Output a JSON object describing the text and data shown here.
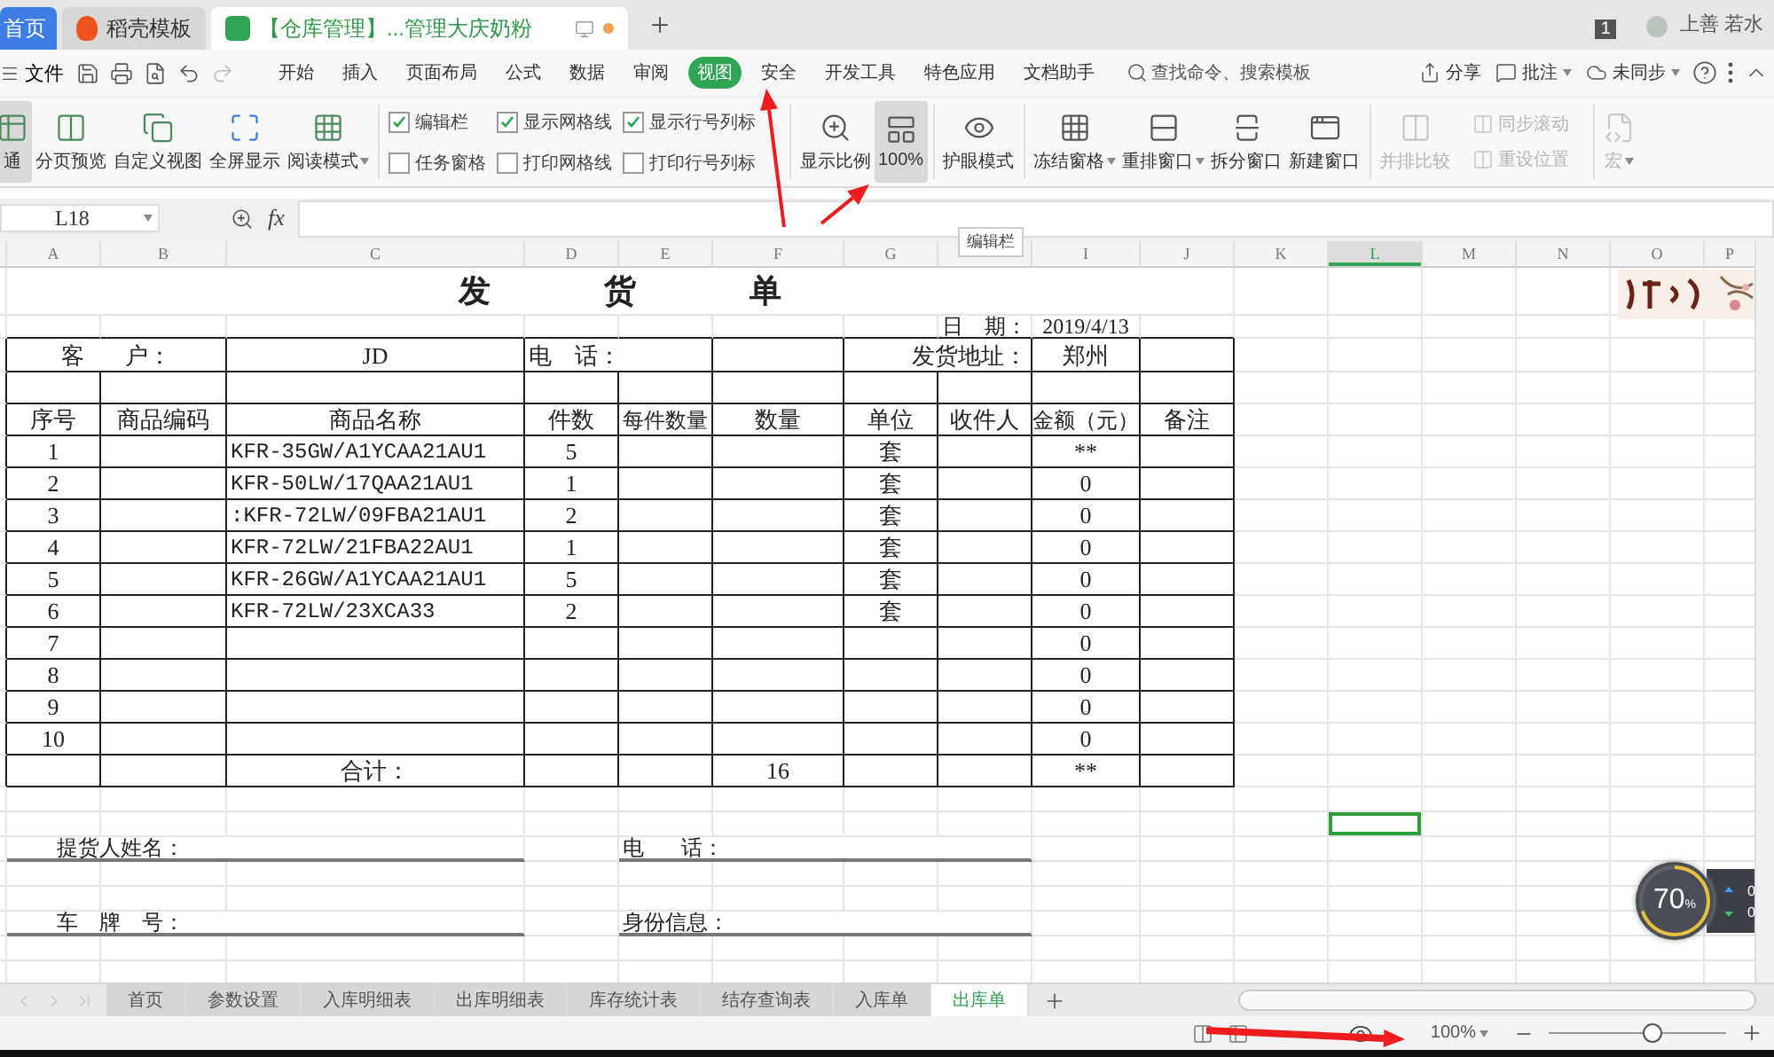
{
  "app_tabs": [
    {
      "label": "首页",
      "kind": "home",
      "selected": false
    },
    {
      "label": "稻壳模板",
      "kind": "docer",
      "selected": false
    },
    {
      "label": "【仓库管理】...管理大庆奶粉",
      "kind": "sheet",
      "selected": true,
      "unsaved": true
    }
  ],
  "account": {
    "badge": "1",
    "user": "上善 若水"
  },
  "file_menu": "文件",
  "menu_tabs": [
    {
      "label": "开始",
      "selected": false
    },
    {
      "label": "插入",
      "selected": false
    },
    {
      "label": "页面布局",
      "selected": false
    },
    {
      "label": "公式",
      "selected": false
    },
    {
      "label": "数据",
      "selected": false
    },
    {
      "label": "审阅",
      "selected": false
    },
    {
      "label": "视图",
      "selected": true
    },
    {
      "label": "安全",
      "selected": false
    },
    {
      "label": "开发工具",
      "selected": false
    },
    {
      "label": "特色应用",
      "selected": false
    },
    {
      "label": "文档助手",
      "selected": false
    }
  ],
  "search": {
    "placeholder": "查找命令、搜索模板"
  },
  "right_actions": [
    {
      "label": "分享",
      "kind": "share",
      "dropdown": false
    },
    {
      "label": "批注",
      "kind": "comment",
      "dropdown": true
    },
    {
      "label": "未同步",
      "kind": "sync",
      "dropdown": true
    }
  ],
  "ribbon": {
    "view_buttons": [
      {
        "label": "通",
        "kind": "normal",
        "selected": true,
        "dropdown": false
      },
      {
        "label": "分页预览",
        "kind": "pagebreak",
        "selected": false,
        "dropdown": false
      },
      {
        "label": "自定义视图",
        "kind": "custom",
        "selected": false,
        "dropdown": false
      },
      {
        "label": "全屏显示",
        "kind": "fullscreen",
        "selected": false,
        "dropdown": false
      },
      {
        "label": "阅读模式",
        "kind": "reading",
        "selected": false,
        "dropdown": true
      }
    ],
    "checkboxes": [
      {
        "label": "编辑栏",
        "checked": true
      },
      {
        "label": "任务窗格",
        "checked": false
      },
      {
        "label": "显示网格线",
        "checked": true
      },
      {
        "label": "打印网格线",
        "checked": false
      },
      {
        "label": "显示行号列标",
        "checked": true
      },
      {
        "label": "打印行号列标",
        "checked": false
      }
    ],
    "zoom_buttons": [
      {
        "label": "显示比例",
        "kind": "zoom",
        "selected": false
      },
      {
        "label": "100%",
        "kind": "actual",
        "selected": true
      }
    ],
    "window_buttons": [
      {
        "label": "护眼模式",
        "kind": "eye",
        "dropdown": false,
        "disabled": false
      },
      {
        "label": "冻结窗格",
        "kind": "freeze",
        "dropdown": true,
        "disabled": false
      },
      {
        "label": "重排窗口",
        "kind": "arrange",
        "dropdown": true,
        "disabled": false
      },
      {
        "label": "拆分窗口",
        "kind": "split",
        "dropdown": false,
        "disabled": false
      },
      {
        "label": "新建窗口",
        "kind": "new",
        "dropdown": false,
        "disabled": false
      },
      {
        "label": "并排比较",
        "kind": "compare",
        "dropdown": false,
        "disabled": true
      }
    ],
    "small_buttons": [
      {
        "label": "同步滚动",
        "disabled": true
      },
      {
        "label": "重设位置",
        "disabled": true
      }
    ],
    "macro": {
      "label": "宏",
      "disabled": true
    }
  },
  "formula_bar": {
    "cell": "L18",
    "fx": "fx"
  },
  "tooltip": "编辑栏",
  "columns": [
    {
      "label": "A",
      "selected": false
    },
    {
      "label": "B",
      "selected": false
    },
    {
      "label": "C",
      "selected": false
    },
    {
      "label": "D",
      "selected": false
    },
    {
      "label": "E",
      "selected": false
    },
    {
      "label": "F",
      "selected": false
    },
    {
      "label": "G",
      "selected": false
    },
    {
      "selected": false
    },
    {
      "label": "I",
      "selected": false
    },
    {
      "label": "J",
      "selected": false
    },
    {
      "label": "K",
      "selected": false
    },
    {
      "label": "L",
      "selected": true
    },
    {
      "label": "M",
      "selected": false
    },
    {
      "label": "N",
      "selected": false
    },
    {
      "label": "O",
      "selected": false
    },
    {
      "label": "P",
      "selected": false
    }
  ],
  "form": {
    "title": [
      "发",
      "货",
      "单"
    ],
    "date_label": "日    期：",
    "date": "2019/4/13",
    "customer_label": "客       户：",
    "customer": "JD",
    "phone_label": "电    话：",
    "address_label": "发货地址：",
    "address": "郑州",
    "headers": [
      "序号",
      "商品编码",
      "商品名称",
      "件数",
      "每件数量",
      "数量",
      "单位",
      "收件人",
      "金额（元）",
      "备注"
    ],
    "rows": [
      {
        "seq": "1",
        "name": "KFR-35GW/A1YCAA21AU1",
        "pieces": "5",
        "unit": "套",
        "amount": "**"
      },
      {
        "seq": "2",
        "name": "KFR-50LW/17QAA21AU1",
        "pieces": "1",
        "unit": "套",
        "amount": "0"
      },
      {
        "seq": "3",
        "name": ":KFR-72LW/09FBA21AU1",
        "pieces": "2",
        "unit": "套",
        "amount": "0"
      },
      {
        "seq": "4",
        "name": "KFR-72LW/21FBA22AU1",
        "pieces": "1",
        "unit": "套",
        "amount": "0"
      },
      {
        "seq": "5",
        "name": "KFR-26GW/A1YCAA21AU1",
        "pieces": "5",
        "unit": "套",
        "amount": "0"
      },
      {
        "seq": "6",
        "name": "KFR-72LW/23XCA33",
        "pieces": "2",
        "unit": "套",
        "amount": "0"
      },
      {
        "seq": "7",
        "amount": "0"
      },
      {
        "seq": "8",
        "amount": "0"
      },
      {
        "seq": "9",
        "amount": "0"
      },
      {
        "seq": "10",
        "amount": "0"
      }
    ],
    "total_label": "合计：",
    "total_qty": "16",
    "total_amount": "**",
    "signatures": [
      {
        "left": "提货人姓名：",
        "right": "电       话："
      },
      {
        "left": "车    牌    号：",
        "right": "身份信息："
      }
    ]
  },
  "net_meter": {
    "percent": "70",
    "unit": "%",
    "level": 0.7,
    "rates": [
      {
        "label": "0",
        "kind": "up"
      },
      {
        "label": "0",
        "kind": "down"
      }
    ]
  },
  "sheet_tabs": [
    {
      "label": "首页",
      "selected": false
    },
    {
      "label": "参数设置",
      "selected": false
    },
    {
      "label": "入库明细表",
      "selected": false
    },
    {
      "label": "出库明细表",
      "selected": false
    },
    {
      "label": "库存统计表",
      "selected": false
    },
    {
      "label": "结存查询表",
      "selected": false
    },
    {
      "label": "入库单",
      "selected": false
    },
    {
      "label": "出库单",
      "selected": true
    }
  ],
  "status_bar": {
    "zoom": "100%",
    "level": 0.58
  }
}
